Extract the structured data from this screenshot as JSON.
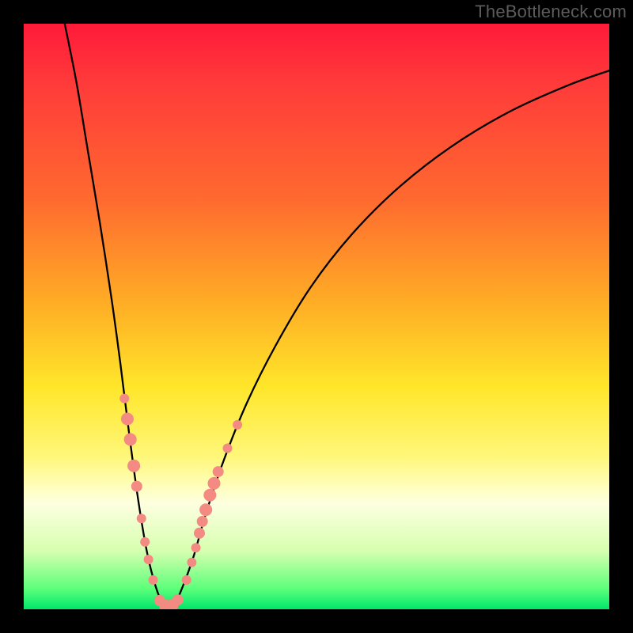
{
  "watermark": "TheBottleneck.com",
  "chart_data": {
    "type": "line",
    "title": "",
    "xlabel": "",
    "ylabel": "",
    "xlim": [
      0,
      100
    ],
    "ylim": [
      0,
      100
    ],
    "curve": {
      "name": "bottleneck-curve",
      "description": "V-shaped bottleneck curve; minimum near x≈24, rising steeply both sides",
      "points": [
        {
          "x": 7.0,
          "y": 100.0
        },
        {
          "x": 9.0,
          "y": 90.0
        },
        {
          "x": 11.0,
          "y": 78.0
        },
        {
          "x": 13.0,
          "y": 66.0
        },
        {
          "x": 15.0,
          "y": 53.0
        },
        {
          "x": 16.5,
          "y": 42.0
        },
        {
          "x": 18.0,
          "y": 30.0
        },
        {
          "x": 19.5,
          "y": 19.0
        },
        {
          "x": 21.0,
          "y": 10.0
        },
        {
          "x": 22.5,
          "y": 4.0
        },
        {
          "x": 24.0,
          "y": 0.5
        },
        {
          "x": 25.5,
          "y": 0.5
        },
        {
          "x": 27.0,
          "y": 3.5
        },
        {
          "x": 29.0,
          "y": 9.0
        },
        {
          "x": 31.0,
          "y": 16.0
        },
        {
          "x": 34.0,
          "y": 25.0
        },
        {
          "x": 38.0,
          "y": 35.0
        },
        {
          "x": 43.0,
          "y": 45.0
        },
        {
          "x": 49.0,
          "y": 55.0
        },
        {
          "x": 56.0,
          "y": 64.0
        },
        {
          "x": 64.0,
          "y": 72.0
        },
        {
          "x": 73.0,
          "y": 79.0
        },
        {
          "x": 83.0,
          "y": 85.0
        },
        {
          "x": 93.0,
          "y": 89.5
        },
        {
          "x": 100.0,
          "y": 92.0
        }
      ]
    },
    "markers": {
      "name": "highlight-dots",
      "color": "#f48b82",
      "points": [
        {
          "x": 17.2,
          "y": 36.0,
          "r": 6
        },
        {
          "x": 17.7,
          "y": 32.5,
          "r": 8
        },
        {
          "x": 18.2,
          "y": 29.0,
          "r": 8
        },
        {
          "x": 18.8,
          "y": 24.5,
          "r": 8
        },
        {
          "x": 19.3,
          "y": 21.0,
          "r": 7
        },
        {
          "x": 20.1,
          "y": 15.5,
          "r": 6
        },
        {
          "x": 20.7,
          "y": 11.5,
          "r": 6
        },
        {
          "x": 21.3,
          "y": 8.5,
          "r": 6
        },
        {
          "x": 22.1,
          "y": 5.0,
          "r": 6
        },
        {
          "x": 23.2,
          "y": 1.5,
          "r": 7
        },
        {
          "x": 24.2,
          "y": 0.6,
          "r": 8
        },
        {
          "x": 25.3,
          "y": 0.6,
          "r": 8
        },
        {
          "x": 26.3,
          "y": 1.6,
          "r": 7
        },
        {
          "x": 27.8,
          "y": 5.0,
          "r": 6
        },
        {
          "x": 28.7,
          "y": 8.0,
          "r": 6
        },
        {
          "x": 29.4,
          "y": 10.5,
          "r": 6
        },
        {
          "x": 30.0,
          "y": 13.0,
          "r": 7
        },
        {
          "x": 30.5,
          "y": 15.0,
          "r": 7
        },
        {
          "x": 31.1,
          "y": 17.0,
          "r": 8
        },
        {
          "x": 31.8,
          "y": 19.5,
          "r": 8
        },
        {
          "x": 32.5,
          "y": 21.5,
          "r": 8
        },
        {
          "x": 33.2,
          "y": 23.5,
          "r": 7
        },
        {
          "x": 34.8,
          "y": 27.5,
          "r": 6
        },
        {
          "x": 36.5,
          "y": 31.5,
          "r": 6
        }
      ]
    },
    "gradient_stops": [
      {
        "pos": 0,
        "color": "#ff1a3a"
      },
      {
        "pos": 0.48,
        "color": "#ffae25"
      },
      {
        "pos": 0.74,
        "color": "#fff77a"
      },
      {
        "pos": 1.0,
        "color": "#00e66a"
      }
    ]
  }
}
